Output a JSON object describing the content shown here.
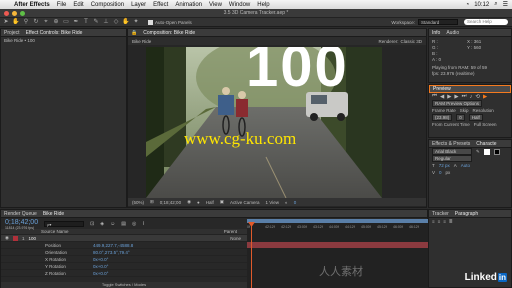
{
  "menubar": {
    "app": "After Effects",
    "items": [
      "File",
      "Edit",
      "Composition",
      "Layer",
      "Effect",
      "Animation",
      "View",
      "Window",
      "Help"
    ],
    "time": "10:12"
  },
  "window": {
    "title": "3.5 3D Camera Tracker.aep *"
  },
  "toolbar": {
    "auto_open_label": "Auto-Open Panels",
    "workspace_label": "Workspace:",
    "workspace_value": "Standard",
    "search_placeholder": "Search Help"
  },
  "project_panel": {
    "tabs": [
      "Project",
      "Effect Controls: Bike Ride"
    ],
    "item": "Bike Ride • 100"
  },
  "composition_panel": {
    "tab": "Composition: Bike Ride",
    "breadcrumb": "Bike Ride",
    "renderer_label": "Renderer:",
    "renderer_value": "Classic 3D"
  },
  "viewer": {
    "overlay_number": "100",
    "watermark": "www.cg-ku.com",
    "zoom": "(50%)",
    "timecode": "0;18;42;00",
    "resolution": "Half",
    "camera": "Active Camera",
    "view": "1 View"
  },
  "info_panel": {
    "tabs": [
      "Info",
      "Audio"
    ],
    "r": "R :",
    "g": "G :",
    "b": "B :",
    "a": "A : 0",
    "x": "X : 361",
    "y": "Y : 560",
    "status1": "Playing from RAM: 59 of 59",
    "status2": "fps: 23.976 (realtime)"
  },
  "preview_panel": {
    "tab": "Preview",
    "ram_options": "RAM Preview Options",
    "frame_rate_label": "Frame Rate",
    "skip_label": "Skip",
    "resolution_label": "Resolution",
    "frame_rate": "(23.98)",
    "skip": "0",
    "resolution": "Half",
    "from_current": "From Current Time",
    "full_screen": "Full Screen"
  },
  "effects_panel": {
    "tab": "Effects & Presets",
    "tab2": "Characte"
  },
  "character_panel": {
    "font": "Arial Black",
    "style": "Regular",
    "size": "72 px",
    "leading": "Auto",
    "tracking": "0",
    "px_label": "px"
  },
  "paragraph_panel": {
    "tabs": [
      "Tracker",
      "Paragraph"
    ]
  },
  "timeline": {
    "tabs": [
      "Render Queue",
      "Bike Ride"
    ],
    "timecode": "0;18;42;00",
    "timecode_sub": "11814 (23.976 fps)",
    "search_placeholder": "ρ▾",
    "column_source": "Source Name",
    "column_parent": "Parent",
    "layer_num": "1",
    "layer_name": "100",
    "layer_parent": "None",
    "properties": [
      {
        "name": "Position",
        "value": "449.9,227.7,-4588.8"
      },
      {
        "name": "Orientation",
        "value": "80.0°,273.5°,79.4°"
      },
      {
        "name": "X Rotation",
        "value": "0x+0.0°"
      },
      {
        "name": "Y Rotation",
        "value": "0x+0.0°"
      },
      {
        "name": "Z Rotation",
        "value": "0x+0.0°"
      }
    ],
    "toggle_label": "Toggle Switches / Modes",
    "ruler": [
      "0f",
      "42:12f",
      "42:12f",
      "43:00f",
      "43:12f",
      "44:00f",
      "44:12f",
      "45:00f",
      "45:12f",
      "46:00f",
      "46:12f",
      "47:00f"
    ]
  },
  "brand": {
    "logo": "Linked",
    "logo_in": "in",
    "wm_cn": "人人素材"
  },
  "colors": {
    "accent": "#f47a1f",
    "cti": "#e05a2b",
    "work_area": "#5a7fa8",
    "watermark": "#ffe600"
  }
}
